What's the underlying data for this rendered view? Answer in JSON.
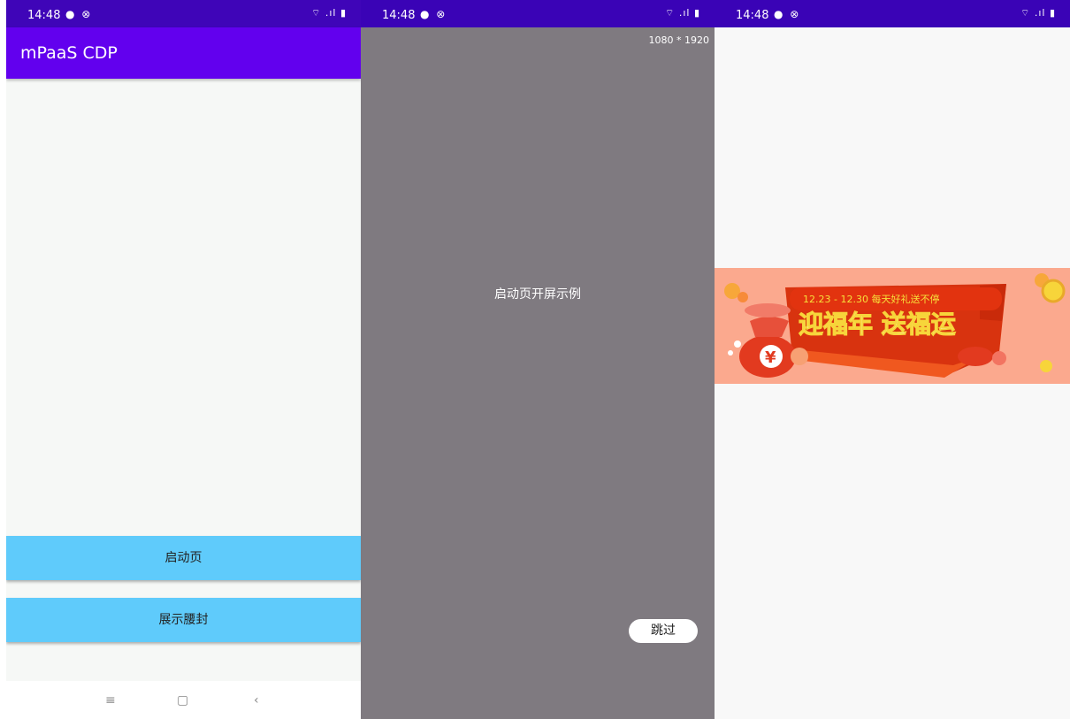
{
  "statusbar": {
    "time": "14:48",
    "left_indicators": "● ⊗",
    "right_indicators": "⌔ .ıl ▮"
  },
  "screen1": {
    "app_title": "mPaaS CDP",
    "launch_button": "启动页",
    "waist_button": "展示腰封",
    "nav": {
      "menu": "≡",
      "home": "▢",
      "back": "‹"
    }
  },
  "screen2": {
    "resolution_label": "1080 * 1920",
    "splash_text": "启动页开屏示例",
    "skip_button": "跳过"
  },
  "screen3": {
    "banner": {
      "date_text": "12.23 - 12.30  每天好礼送不停",
      "headline": "迎福年 送福运",
      "colors": {
        "background": "#fba98e",
        "ribbon": "#e2330f",
        "gold": "#f7d53a"
      }
    }
  }
}
